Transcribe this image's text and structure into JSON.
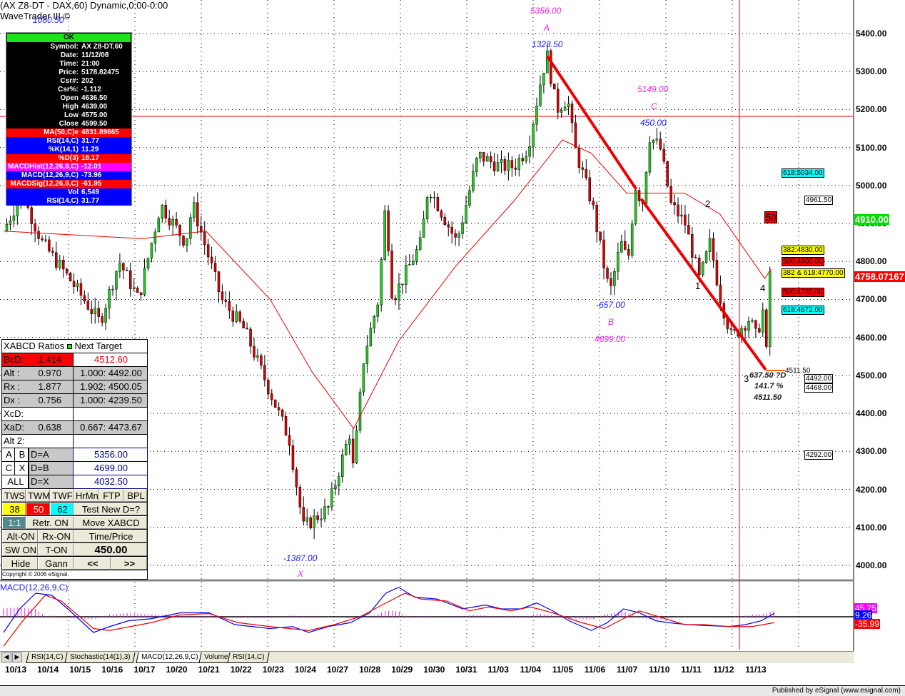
{
  "header": {
    "title": "(AX Z8-DT - DAX,60) Dynamic,0:00-0:00",
    "subtitle": "WaveTrader III ©"
  },
  "info_box": {
    "ok": "OK",
    "rows": [
      {
        "k": "Symbol:",
        "v": "AX Z8-DT,60",
        "bg": "#000000"
      },
      {
        "k": "Date:",
        "v": "11/12/08",
        "bg": "#000000"
      },
      {
        "k": "Time:",
        "v": "21:00",
        "bg": "#000000"
      },
      {
        "k": "Price:",
        "v": "5178.82475",
        "bg": "#000000"
      },
      {
        "k": "Csr#:",
        "v": "202",
        "bg": "#000000"
      },
      {
        "k": "Csr%:",
        "v": "-1.112",
        "bg": "#000000"
      },
      {
        "k": "Open",
        "v": "4636.50",
        "bg": "#000000"
      },
      {
        "k": "High",
        "v": "4639.00",
        "bg": "#000000"
      },
      {
        "k": "Low",
        "v": "4575.00",
        "bg": "#000000"
      },
      {
        "k": "Close",
        "v": "4599.50",
        "bg": "#000000"
      },
      {
        "k": "MA(50,C)e",
        "v": "4831.89665",
        "bg": "#ff0000"
      },
      {
        "k": "RSI(14,C)",
        "v": "31.77",
        "bg": "#0000ff"
      },
      {
        "k": "%K(14,1)",
        "v": "11.29",
        "bg": "#0000ff"
      },
      {
        "k": "%D(3)",
        "v": "18.17",
        "bg": "#ff0000"
      },
      {
        "k": "MACDHist(12,26,9,C)",
        "v": "-12.01",
        "bg": "#ff00ff"
      },
      {
        "k": "MACD(12,26,9,C)",
        "v": "-73.96",
        "bg": "#0000ff"
      },
      {
        "k": "MACDSig(12,26,9,C)",
        "v": "-61.95",
        "bg": "#ff0000"
      },
      {
        "k": "Vol",
        "v": "6,549",
        "bg": "#0000ff"
      },
      {
        "k": "RSI(14,C)",
        "v": "31.77",
        "bg": "#0000ff"
      }
    ]
  },
  "annotations": {
    "top_left": "1080.50",
    "A_price": "5356.00",
    "A": "A",
    "A_swing": "1323.50",
    "C_price": "5149.00",
    "C": "C",
    "C_swing": "450.00",
    "B_swing": "-657.00",
    "B": "B",
    "B_price": "4699.00",
    "X_swing": "-1387.00",
    "X": "X",
    "w1": "1",
    "w2": "2",
    "w3": "3",
    "w4": "4",
    "w50": "50",
    "d_swing": "637.50 ?D",
    "d_pct": "141.7 %",
    "d_price": "4511.50",
    "d_line": "4511.50"
  },
  "level_tags": [
    {
      "text": "618:5034.00",
      "price": 5034,
      "bg": "#00ffff"
    },
    {
      "text": "4961.50",
      "price": 4961.5,
      "bg": "#ffffff"
    },
    {
      "text": "382:4830.00",
      "price": 4830,
      "bg": "#ffff00"
    },
    {
      "text": "500:4800.00",
      "price": 4800,
      "bg": "#ff0000"
    },
    {
      "text": "382 & 618:4770.00",
      "price": 4770,
      "bg": "#ffff00"
    },
    {
      "text": "500:4720.00",
      "price": 4720,
      "bg": "#ff0000"
    },
    {
      "text": "618:4672.00",
      "price": 4672,
      "bg": "#00ffff"
    },
    {
      "text": "4492.00",
      "price": 4492,
      "bg": "#ffffff"
    },
    {
      "text": "4468.00",
      "price": 4468,
      "bg": "#ffffff"
    },
    {
      "text": "4292.00",
      "price": 4292,
      "bg": "#ffffff"
    }
  ],
  "price_markers": {
    "last": "4910.00",
    "last_color": "#00dd00",
    "cursor": "4758.07167",
    "cursor_color": "#ff0000"
  },
  "macd_markers": {
    "hist": "45.25",
    "macd": "9.26",
    "signal": "-35.99"
  },
  "xabcd": {
    "header_left": "XABCD Ratios",
    "header_right": "Next Target",
    "rows": [
      {
        "l": "BcD:",
        "v": "1.414",
        "r": "4512.60"
      },
      {
        "l": "Alt  :",
        "v": "0.970",
        "r": "1.000: 4492.00"
      },
      {
        "l": "Rx   :",
        "v": "1.877",
        "r": "1.902: 4500.05"
      },
      {
        "l": "Dx   :",
        "v": "0.756",
        "r": "1.000: 4239.50"
      },
      {
        "l": "XcD:",
        "v": "",
        "r": ""
      },
      {
        "l": "XaD:",
        "v": "0.638",
        "r": "0.667: 4473.67"
      },
      {
        "l": "Alt 2:",
        "v": "",
        "r": ""
      }
    ],
    "points": [
      {
        "a": "A",
        "b": "B",
        "eq": "D=A",
        "val": "5356.00"
      },
      {
        "a": "C",
        "b": "X",
        "eq": "D=B",
        "val": "4699.00"
      },
      {
        "a": "ALL",
        "b": "",
        "eq": "D=X",
        "val": "4032.50"
      }
    ],
    "buttons": {
      "tws": "TWS",
      "twm": "TWM",
      "twf": "TWF",
      "hrmn": "HrMn",
      "ftp": "FTP",
      "bpl": "BPL",
      "r38": "38",
      "r50": "50",
      "r62": "62",
      "test": "Test New D=?",
      "one": "1:1",
      "retr": "Retr. ON",
      "move": "Move XABCD",
      "alt": "Alt-ON",
      "rx": "Rx-ON",
      "tp": "Time/Price",
      "sw": "SW ON",
      "ton": "T-ON",
      "val": "450.00",
      "hide": "Hide",
      "gann": "Gann",
      "prev": "<<",
      "next": ">>"
    },
    "copyright": "Copyright © 2006 eSignal."
  },
  "tabs": [
    "RSI(14,C)",
    "Stochastic(14(1),3)",
    "MACD(12,26,9,C)",
    "Volume",
    "RSI(14,C)"
  ],
  "active_tab": 2,
  "footer": "Published by eSignal (www.esignal.com)",
  "chart_data": [
    {
      "type": "candlestick",
      "title": "(AX Z8-DT - DAX,60) Dynamic,0:00-0:00",
      "x_unit": "trading days since 10/13",
      "x_tick_labels": [
        "10/13",
        "10/14",
        "10/15",
        "10/16",
        "10/17",
        "10/20",
        "10/21",
        "10/22",
        "10/23",
        "10/24",
        "10/27",
        "10/28",
        "10/29",
        "10/30",
        "10/31",
        "11/03",
        "11/04",
        "11/05",
        "11/06",
        "11/07",
        "11/10",
        "11/11",
        "11/12",
        "11/13"
      ],
      "y_ticks": [
        "5400.00",
        "5300.00",
        "5200.00",
        "5100.00",
        "5000.00",
        "4900.00",
        "4800.00",
        "4700.00",
        "4600.00",
        "4500.00",
        "4400.00",
        "4300.00",
        "4200.00",
        "4100.00",
        "4000.00"
      ],
      "ylim": [
        4000,
        5400
      ],
      "price_path": [
        [
          0,
          4880
        ],
        [
          0.56,
          4980
        ],
        [
          1.2,
          4850
        ],
        [
          2,
          4760
        ],
        [
          3,
          4640
        ],
        [
          3.6,
          4800
        ],
        [
          4.2,
          4700
        ],
        [
          4.89,
          4950
        ],
        [
          5.67,
          4850
        ],
        [
          5.89,
          4950
        ],
        [
          6.78,
          4700
        ],
        [
          7.5,
          4620
        ],
        [
          8.33,
          4450
        ],
        [
          8.9,
          4330
        ],
        [
          9.33,
          4100
        ],
        [
          10.11,
          4150
        ],
        [
          10.78,
          4350
        ],
        [
          10.89,
          4250
        ],
        [
          11.22,
          4550
        ],
        [
          11.67,
          4700
        ],
        [
          11.89,
          4950
        ],
        [
          12.11,
          4700
        ],
        [
          13.0,
          4850
        ],
        [
          13.22,
          5000
        ],
        [
          14.11,
          4850
        ],
        [
          14.78,
          5080
        ],
        [
          15.44,
          5050
        ],
        [
          15.89,
          5050
        ],
        [
          16.33,
          5100
        ],
        [
          16.78,
          5300
        ],
        [
          16.93,
          5340
        ],
        [
          17.22,
          5200
        ],
        [
          17.56,
          5230
        ],
        [
          17.78,
          5100
        ],
        [
          18.33,
          4950
        ],
        [
          18.78,
          4750
        ],
        [
          18.89,
          4720
        ],
        [
          19.22,
          4850
        ],
        [
          19.44,
          4800
        ],
        [
          19.67,
          5000
        ],
        [
          19.89,
          4950
        ],
        [
          20.11,
          5130
        ],
        [
          20.44,
          5100
        ],
        [
          20.78,
          4950
        ],
        [
          21.22,
          4900
        ],
        [
          21.67,
          4750
        ],
        [
          22.0,
          4850
        ],
        [
          22.33,
          4700
        ],
        [
          22.67,
          4600
        ],
        [
          23.22,
          4650
        ],
        [
          23.44,
          4600
        ],
        [
          23.67,
          4680
        ],
        [
          23.73,
          4520
        ],
        [
          23.93,
          4910
        ]
      ],
      "ma50_path": [
        [
          0,
          4880
        ],
        [
          4.3,
          4860
        ],
        [
          6.3,
          4880
        ],
        [
          8.3,
          4700
        ],
        [
          9.6,
          4510
        ],
        [
          10.9,
          4360
        ],
        [
          12.3,
          4590
        ],
        [
          14.1,
          4790
        ],
        [
          15.9,
          4960
        ],
        [
          17.4,
          5120
        ],
        [
          18.3,
          5085
        ],
        [
          19.4,
          4980
        ],
        [
          21.2,
          4980
        ],
        [
          22.3,
          4925
        ],
        [
          23.7,
          4755
        ],
        [
          23.9,
          4780
        ]
      ],
      "horizontal_line": 5182,
      "trend_lines": [
        [
          [
            16.93,
            5340
          ],
          [
            19.7,
            4990
          ]
        ],
        [
          [
            19.85,
            4965
          ],
          [
            23.73,
            4515
          ]
        ]
      ]
    },
    {
      "type": "line",
      "title": "MACD(12,26,9,C)",
      "ylim": [
        -80,
        80
      ],
      "macd": [
        [
          0,
          -40
        ],
        [
          0.5,
          20
        ],
        [
          1,
          60
        ],
        [
          1.5,
          55
        ],
        [
          2,
          20
        ],
        [
          2.8,
          -40
        ],
        [
          3.3,
          -25
        ],
        [
          3.9,
          -10
        ],
        [
          4.6,
          -5
        ],
        [
          5.5,
          10
        ],
        [
          6.4,
          10
        ],
        [
          7.2,
          -20
        ],
        [
          8.3,
          -30
        ],
        [
          9,
          -25
        ],
        [
          9.5,
          -40
        ],
        [
          10.1,
          -25
        ],
        [
          10.8,
          -15
        ],
        [
          11.4,
          10
        ],
        [
          11.9,
          60
        ],
        [
          12.3,
          75
        ],
        [
          12.8,
          50
        ],
        [
          13.5,
          45
        ],
        [
          14.3,
          20
        ],
        [
          15,
          30
        ],
        [
          15.5,
          20
        ],
        [
          16.1,
          20
        ],
        [
          16.6,
          35
        ],
        [
          17.1,
          15
        ],
        [
          17.6,
          -10
        ],
        [
          18.3,
          -35
        ],
        [
          18.8,
          -15
        ],
        [
          19.3,
          20
        ],
        [
          19.8,
          10
        ],
        [
          20.3,
          -10
        ],
        [
          20.7,
          -15
        ],
        [
          21.3,
          -20
        ],
        [
          21.8,
          -22
        ],
        [
          22.6,
          -25
        ],
        [
          23.1,
          -20
        ],
        [
          23.6,
          -10
        ],
        [
          24,
          9
        ]
      ],
      "signal": [
        [
          0,
          -75
        ],
        [
          0.6,
          -10
        ],
        [
          1.3,
          55
        ],
        [
          1.8,
          40
        ],
        [
          2.8,
          -30
        ],
        [
          3.3,
          -35
        ],
        [
          4.6,
          -15
        ],
        [
          5.5,
          5
        ],
        [
          6.4,
          8
        ],
        [
          7.3,
          -15
        ],
        [
          8.3,
          -25
        ],
        [
          9.5,
          -35
        ],
        [
          10.3,
          -20
        ],
        [
          11.1,
          0
        ],
        [
          11.9,
          35
        ],
        [
          12.5,
          60
        ],
        [
          13,
          45
        ],
        [
          13.8,
          40
        ],
        [
          14.5,
          15
        ],
        [
          15.1,
          25
        ],
        [
          15.8,
          15
        ],
        [
          16.4,
          25
        ],
        [
          17.1,
          10
        ],
        [
          18,
          -15
        ],
        [
          18.7,
          -30
        ],
        [
          19.3,
          -5
        ],
        [
          19.8,
          15
        ],
        [
          20.4,
          0
        ],
        [
          21.2,
          -20
        ],
        [
          21.8,
          -20
        ],
        [
          22.6,
          -25
        ],
        [
          23.3,
          -25
        ],
        [
          24,
          -15
        ]
      ]
    }
  ]
}
